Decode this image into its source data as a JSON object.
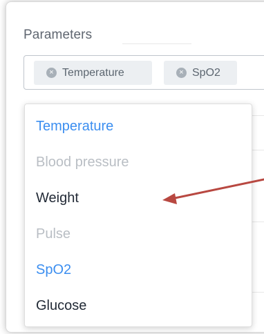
{
  "form": {
    "label": "Parameters",
    "selected_chips": [
      {
        "label": "Temperature",
        "remove_icon": "close-circle-icon"
      },
      {
        "label": "SpO2",
        "remove_icon": "close-circle-icon"
      }
    ]
  },
  "dropdown": {
    "options": [
      {
        "label": "Temperature",
        "state": "selected"
      },
      {
        "label": "Blood pressure",
        "state": "disabled"
      },
      {
        "label": "Weight",
        "state": "normal"
      },
      {
        "label": "Pulse",
        "state": "disabled"
      },
      {
        "label": "SpO2",
        "state": "selected"
      },
      {
        "label": "Glucose",
        "state": "normal"
      }
    ]
  },
  "annotation": {
    "icon": "red-arrow-icon",
    "color": "#b84841"
  },
  "colors": {
    "selected": "#3b8ef0",
    "disabled": "#b9bec4",
    "normal": "#222a36",
    "chip_background": "#eceff2"
  }
}
